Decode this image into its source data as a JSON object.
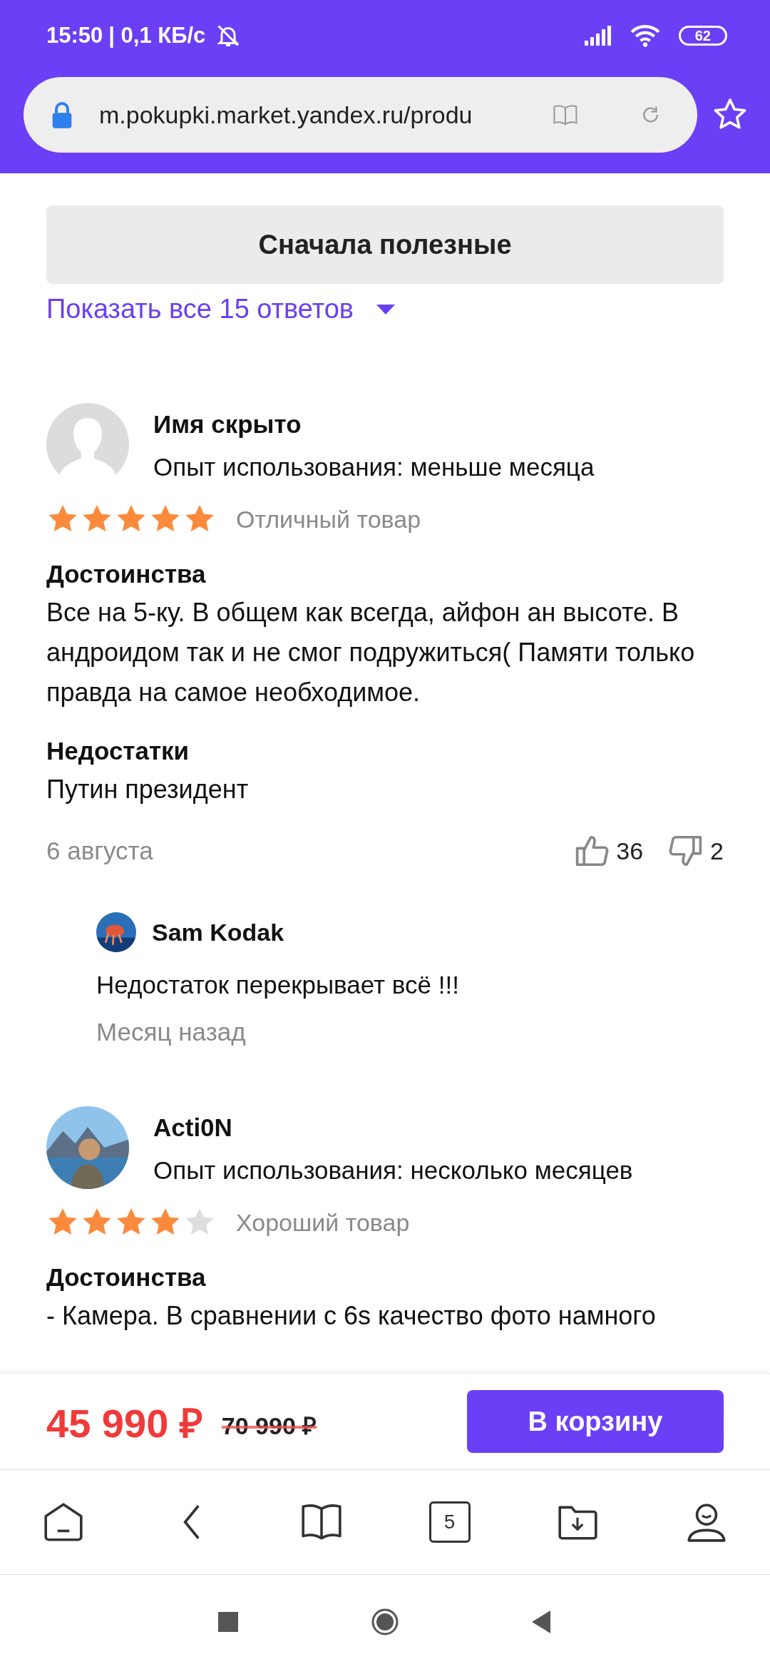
{
  "status_bar": {
    "time": "15:50",
    "speed": "| 0,1 КБ/с",
    "battery": "62"
  },
  "address_bar": {
    "url": "m.pokupki.market.yandex.ru/produ"
  },
  "sort_button": {
    "label": "Сначала полезные"
  },
  "show_answers_link": {
    "label": "Показать все 15 ответов"
  },
  "reviews": [
    {
      "author": "Имя скрыто",
      "avatar": {
        "kind": "placeholder"
      },
      "experience": "Опыт использования: меньше месяца",
      "stars": 5,
      "verdict": "Отличный товар",
      "sections": [
        {
          "heading": "Достоинства",
          "text": "Все на 5-ку. В общем как всегда, айфон ан высоте. В андроидом так и не смог подружиться( Памяти только правда на самое необходимое."
        },
        {
          "heading": "Недостатки",
          "text": "Путин президент"
        }
      ],
      "date": "6 августа",
      "likes": "36",
      "dislikes": "2",
      "comments": [
        {
          "author": "Sam Kodak",
          "text": "Недостаток перекрывает всё !!!",
          "time": "Месяц назад"
        }
      ]
    },
    {
      "author": "Acti0N",
      "avatar": {
        "kind": "picture"
      },
      "experience": "Опыт использования: несколько месяцев",
      "stars": 4,
      "verdict": "Хороший товар",
      "sections": [
        {
          "heading": "Достоинства",
          "text": "- Камера. В сравнении с 6s качество фото намного"
        }
      ]
    }
  ],
  "purchase_bar": {
    "price": "45 990 ₽",
    "old_price": "70 990 ₽",
    "button": "В корзину"
  },
  "browser_nav": {
    "tabs_count": "5"
  }
}
